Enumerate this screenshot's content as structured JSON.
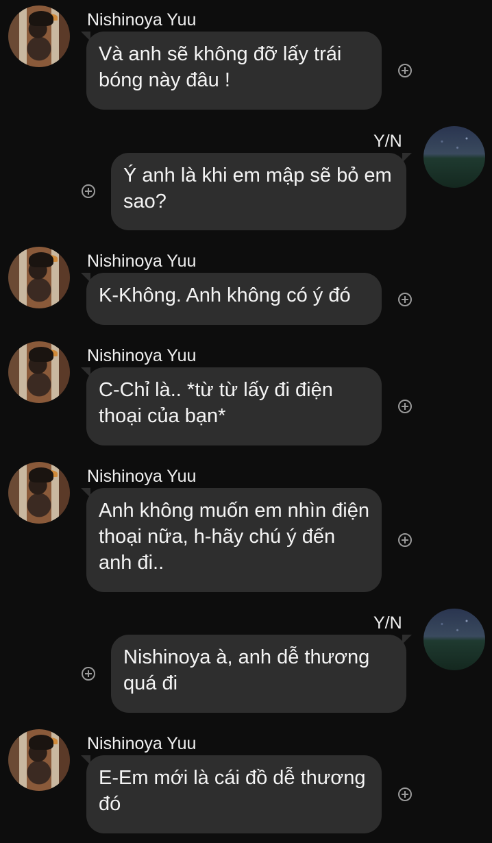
{
  "colors": {
    "background": "#0d0d0d",
    "bubble": "#2e2e2e",
    "text": "#f4f4f4",
    "icon": "#9a9a9a"
  },
  "messages": [
    {
      "sender": "Nishinoya Yuu",
      "side": "left",
      "text": "Và anh sẽ không đỡ lấy trái bóng này đâu !",
      "icon": "plus-circle-icon"
    },
    {
      "sender": "Y/N",
      "side": "right",
      "text": "Ý anh là khi em mập sẽ bỏ em sao?",
      "icon": "plus-circle-icon"
    },
    {
      "sender": "Nishinoya Yuu",
      "side": "left",
      "text": "K-Không. Anh không có ý đó",
      "icon": "plus-circle-icon"
    },
    {
      "sender": "Nishinoya Yuu",
      "side": "left",
      "text": "C-Chỉ là.. *từ từ lấy đi điện thoại của bạn*",
      "icon": "plus-circle-icon"
    },
    {
      "sender": "Nishinoya Yuu",
      "side": "left",
      "text": "Anh không muốn em nhìn điện thoại nữa, h-hãy chú ý đến anh đi..",
      "icon": "plus-circle-icon"
    },
    {
      "sender": "Y/N",
      "side": "right",
      "text": "Nishinoya à, anh dễ thương quá đi",
      "icon": "plus-circle-icon"
    },
    {
      "sender": "Nishinoya Yuu",
      "side": "left",
      "text": "E-Em mới là cái đồ dễ thương đó",
      "icon": "plus-circle-icon"
    }
  ]
}
